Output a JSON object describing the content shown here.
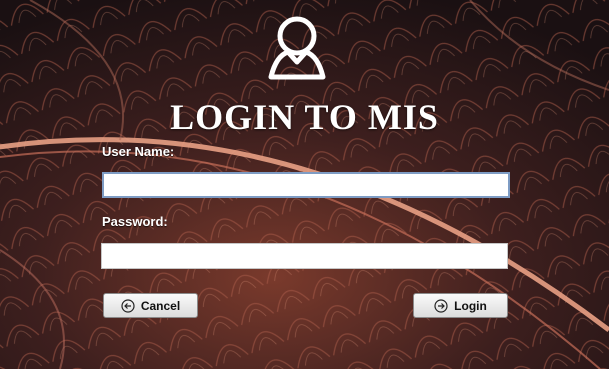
{
  "login": {
    "title": "LOGIN TO MIS",
    "username_label": "User Name:",
    "username_value": "",
    "password_label": "Password:",
    "password_value": "",
    "cancel_label": "Cancel",
    "login_label": "Login"
  },
  "icons": {
    "user": "user-icon",
    "cancel": "back-arrow-circle-icon",
    "login": "forward-arrow-circle-icon"
  },
  "colors": {
    "title_text": "#ffffff",
    "field_border": "#7e9cc4"
  }
}
